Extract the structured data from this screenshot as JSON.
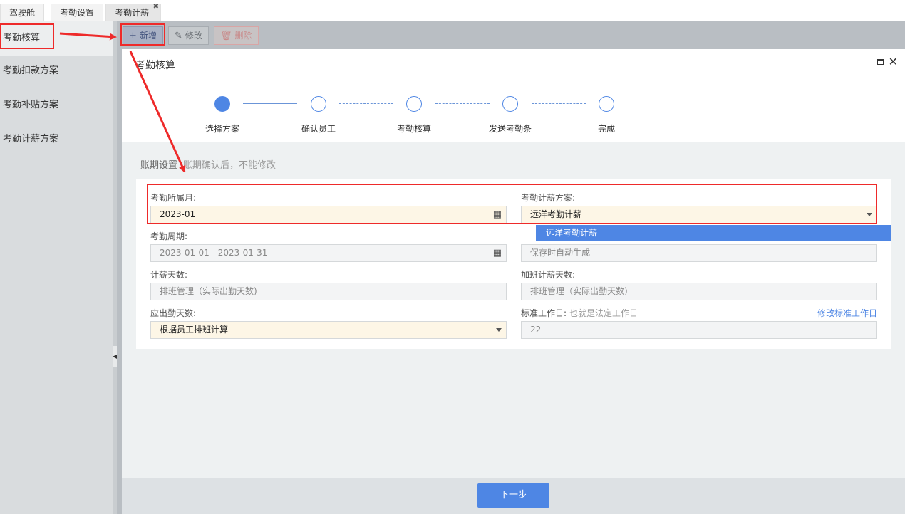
{
  "top_tabs": [
    {
      "label": "驾驶舱"
    },
    {
      "label": "考勤设置"
    },
    {
      "label": "考勤计薪",
      "close": "✖"
    }
  ],
  "sidebar": {
    "items": [
      {
        "label": "考勤核算"
      },
      {
        "label": "考勤扣款方案"
      },
      {
        "label": "考勤补贴方案"
      },
      {
        "label": "考勤计薪方案"
      }
    ]
  },
  "toolbar": {
    "add_label": "新增",
    "edit_label": "修改",
    "delete_label": "删除"
  },
  "dialog": {
    "title": "考勤核算",
    "steps": [
      {
        "label": "选择方案",
        "done": true
      },
      {
        "label": "确认员工",
        "done": false
      },
      {
        "label": "考勤核算",
        "done": false
      },
      {
        "label": "发送考勤条",
        "done": false
      },
      {
        "label": "完成",
        "done": false
      }
    ],
    "section_title": "账期设置",
    "section_hint": "账期确认后，不能修改",
    "form": {
      "month_label": "考勤所属月:",
      "month_value": "2023-01",
      "plan_label": "考勤计薪方案:",
      "plan_value": "远洋考勤计薪",
      "plan_dropdown_option": "远洋考勤计薪",
      "period_label": "考勤周期:",
      "period_value": "2023-01-01 - 2023-01-31",
      "code_placeholder": "保存时自动生成",
      "paydays_label": "计薪天数:",
      "paydays_value": "排班管理（实际出勤天数)",
      "ot_label": "加班计薪天数:",
      "ot_value": "排班管理（实际出勤天数)",
      "required_label": "应出勤天数:",
      "required_value": "根据员工排班计算",
      "std_label": "标准工作日:",
      "std_hint": "也就是法定工作日",
      "std_link": "修改标准工作日",
      "std_value": "22"
    },
    "next_label": "下一步"
  },
  "colors": {
    "accent": "#4e86e4",
    "annotation": "#ee2a2a",
    "highlight_field": "#fdf6e6"
  }
}
